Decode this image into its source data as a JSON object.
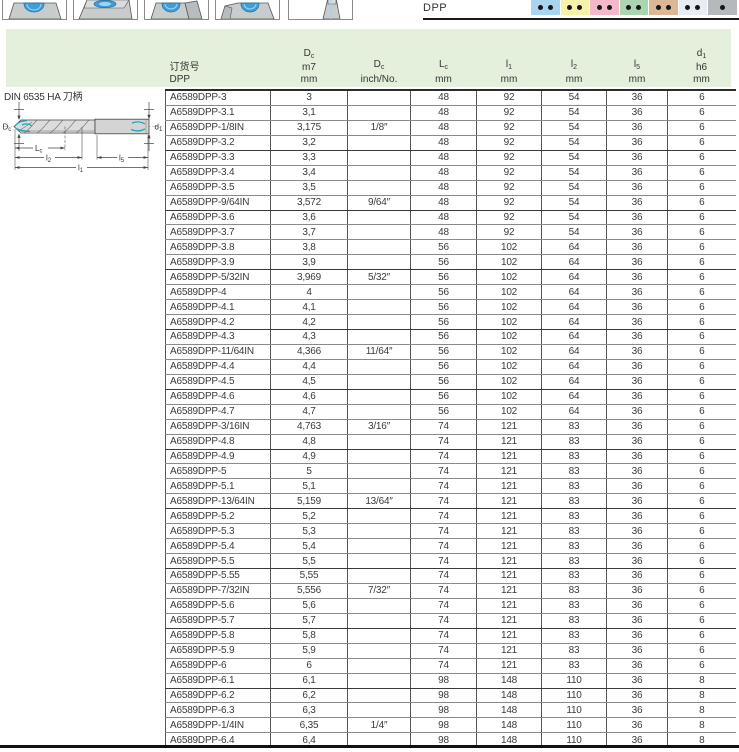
{
  "top_bar": {
    "dpp_label": "DPP",
    "swatches": [
      {
        "color": "#a9d4ef",
        "dots": 2
      },
      {
        "color": "#f6f1ab",
        "dots": 2
      },
      {
        "color": "#f3b9ca",
        "dots": 2
      },
      {
        "color": "#abd5b1",
        "dots": 2
      },
      {
        "color": "#dcb795",
        "dots": 2
      },
      {
        "color": "#e7edf2",
        "dots": 2
      },
      {
        "color": "#b5b9bb",
        "dots": 1
      }
    ]
  },
  "section": {
    "din_label": "DIN 6535 HA 刀柄"
  },
  "diagram": {
    "labels": {
      "dc": {
        "main": "D",
        "sub": "c"
      },
      "d1": {
        "main": "d",
        "sub": "1"
      },
      "lc": {
        "main": "L",
        "sub": "c"
      },
      "l2": {
        "main": "l",
        "sub": "2"
      },
      "l5": {
        "main": "l",
        "sub": "5"
      },
      "l1": {
        "main": "l",
        "sub": "1"
      }
    }
  },
  "table": {
    "columns": [
      {
        "lines": [
          "订货号",
          "DPP"
        ],
        "align": "left"
      },
      {
        "sym": "D",
        "sub": "c",
        "lines": [
          "m7",
          "mm"
        ]
      },
      {
        "sym": "D",
        "sub": "c",
        "lines": [
          "inch/No."
        ]
      },
      {
        "sym": "L",
        "sub": "c",
        "lines": [
          "mm"
        ]
      },
      {
        "sym": "l",
        "sub": "1",
        "lines": [
          "mm"
        ]
      },
      {
        "sym": "l",
        "sub": "2",
        "lines": [
          "mm"
        ]
      },
      {
        "sym": "l",
        "sub": "5",
        "lines": [
          "mm"
        ]
      },
      {
        "sym": "d",
        "sub": "1",
        "lines": [
          "h6",
          "mm"
        ]
      }
    ],
    "rows": [
      [
        "A6589DPP-3",
        "3",
        "",
        "48",
        "92",
        "54",
        "36",
        "6"
      ],
      [
        "A6589DPP-3.1",
        "3,1",
        "",
        "48",
        "92",
        "54",
        "36",
        "6"
      ],
      [
        "A6589DPP-1/8IN",
        "3,175",
        "1/8″",
        "48",
        "92",
        "54",
        "36",
        "6"
      ],
      [
        "A6589DPP-3.2",
        "3,2",
        "",
        "48",
        "92",
        "54",
        "36",
        "6"
      ],
      [
        "A6589DPP-3.3",
        "3,3",
        "",
        "48",
        "92",
        "54",
        "36",
        "6"
      ],
      [
        "A6589DPP-3.4",
        "3,4",
        "",
        "48",
        "92",
        "54",
        "36",
        "6"
      ],
      [
        "A6589DPP-3.5",
        "3,5",
        "",
        "48",
        "92",
        "54",
        "36",
        "6"
      ],
      [
        "A6589DPP-9/64IN",
        "3,572",
        "9/64″",
        "48",
        "92",
        "54",
        "36",
        "6"
      ],
      [
        "A6589DPP-3.6",
        "3,6",
        "",
        "48",
        "92",
        "54",
        "36",
        "6"
      ],
      [
        "A6589DPP-3.7",
        "3,7",
        "",
        "48",
        "92",
        "54",
        "36",
        "6"
      ],
      [
        "A6589DPP-3.8",
        "3,8",
        "",
        "56",
        "102",
        "64",
        "36",
        "6"
      ],
      [
        "A6589DPP-3.9",
        "3,9",
        "",
        "56",
        "102",
        "64",
        "36",
        "6"
      ],
      [
        "A6589DPP-5/32IN",
        "3,969",
        "5/32″",
        "56",
        "102",
        "64",
        "36",
        "6"
      ],
      [
        "A6589DPP-4",
        "4",
        "",
        "56",
        "102",
        "64",
        "36",
        "6"
      ],
      [
        "A6589DPP-4.1",
        "4,1",
        "",
        "56",
        "102",
        "64",
        "36",
        "6"
      ],
      [
        "A6589DPP-4.2",
        "4,2",
        "",
        "56",
        "102",
        "64",
        "36",
        "6"
      ],
      [
        "A6589DPP-4.3",
        "4,3",
        "",
        "56",
        "102",
        "64",
        "36",
        "6"
      ],
      [
        "A6589DPP-11/64IN",
        "4,366",
        "11/64″",
        "56",
        "102",
        "64",
        "36",
        "6"
      ],
      [
        "A6589DPP-4.4",
        "4,4",
        "",
        "56",
        "102",
        "64",
        "36",
        "6"
      ],
      [
        "A6589DPP-4.5",
        "4,5",
        "",
        "56",
        "102",
        "64",
        "36",
        "6"
      ],
      [
        "A6589DPP-4.6",
        "4,6",
        "",
        "56",
        "102",
        "64",
        "36",
        "6"
      ],
      [
        "A6589DPP-4.7",
        "4,7",
        "",
        "56",
        "102",
        "64",
        "36",
        "6"
      ],
      [
        "A6589DPP-3/16IN",
        "4,763",
        "3/16″",
        "74",
        "121",
        "83",
        "36",
        "6"
      ],
      [
        "A6589DPP-4.8",
        "4,8",
        "",
        "74",
        "121",
        "83",
        "36",
        "6"
      ],
      [
        "A6589DPP-4.9",
        "4,9",
        "",
        "74",
        "121",
        "83",
        "36",
        "6"
      ],
      [
        "A6589DPP-5",
        "5",
        "",
        "74",
        "121",
        "83",
        "36",
        "6"
      ],
      [
        "A6589DPP-5.1",
        "5,1",
        "",
        "74",
        "121",
        "83",
        "36",
        "6"
      ],
      [
        "A6589DPP-13/64IN",
        "5,159",
        "13/64″",
        "74",
        "121",
        "83",
        "36",
        "6"
      ],
      [
        "A6589DPP-5.2",
        "5,2",
        "",
        "74",
        "121",
        "83",
        "36",
        "6"
      ],
      [
        "A6589DPP-5.3",
        "5,3",
        "",
        "74",
        "121",
        "83",
        "36",
        "6"
      ],
      [
        "A6589DPP-5.4",
        "5,4",
        "",
        "74",
        "121",
        "83",
        "36",
        "6"
      ],
      [
        "A6589DPP-5.5",
        "5,5",
        "",
        "74",
        "121",
        "83",
        "36",
        "6"
      ],
      [
        "A6589DPP-5.55",
        "5,55",
        "",
        "74",
        "121",
        "83",
        "36",
        "6"
      ],
      [
        "A6589DPP-7/32IN",
        "5,556",
        "7/32″",
        "74",
        "121",
        "83",
        "36",
        "6"
      ],
      [
        "A6589DPP-5.6",
        "5,6",
        "",
        "74",
        "121",
        "83",
        "36",
        "6"
      ],
      [
        "A6589DPP-5.7",
        "5,7",
        "",
        "74",
        "121",
        "83",
        "36",
        "6"
      ],
      [
        "A6589DPP-5.8",
        "5,8",
        "",
        "74",
        "121",
        "83",
        "36",
        "6"
      ],
      [
        "A6589DPP-5.9",
        "5,9",
        "",
        "74",
        "121",
        "83",
        "36",
        "6"
      ],
      [
        "A6589DPP-6",
        "6",
        "",
        "74",
        "121",
        "83",
        "36",
        "6"
      ],
      [
        "A6589DPP-6.1",
        "6,1",
        "",
        "98",
        "148",
        "110",
        "36",
        "8"
      ],
      [
        "A6589DPP-6.2",
        "6,2",
        "",
        "98",
        "148",
        "110",
        "36",
        "8"
      ],
      [
        "A6589DPP-6.3",
        "6,3",
        "",
        "98",
        "148",
        "110",
        "36",
        "8"
      ],
      [
        "A6589DPP-1/4IN",
        "6,35",
        "1/4″",
        "98",
        "148",
        "110",
        "36",
        "8"
      ],
      [
        "A6589DPP-6.4",
        "6,4",
        "",
        "98",
        "148",
        "110",
        "36",
        "8"
      ]
    ]
  },
  "colors": {
    "header_green": "#e4f0dc",
    "accent_blue": "#3e9fd8",
    "teal": "#1fa3bc",
    "swatch_dot": "#161616"
  }
}
